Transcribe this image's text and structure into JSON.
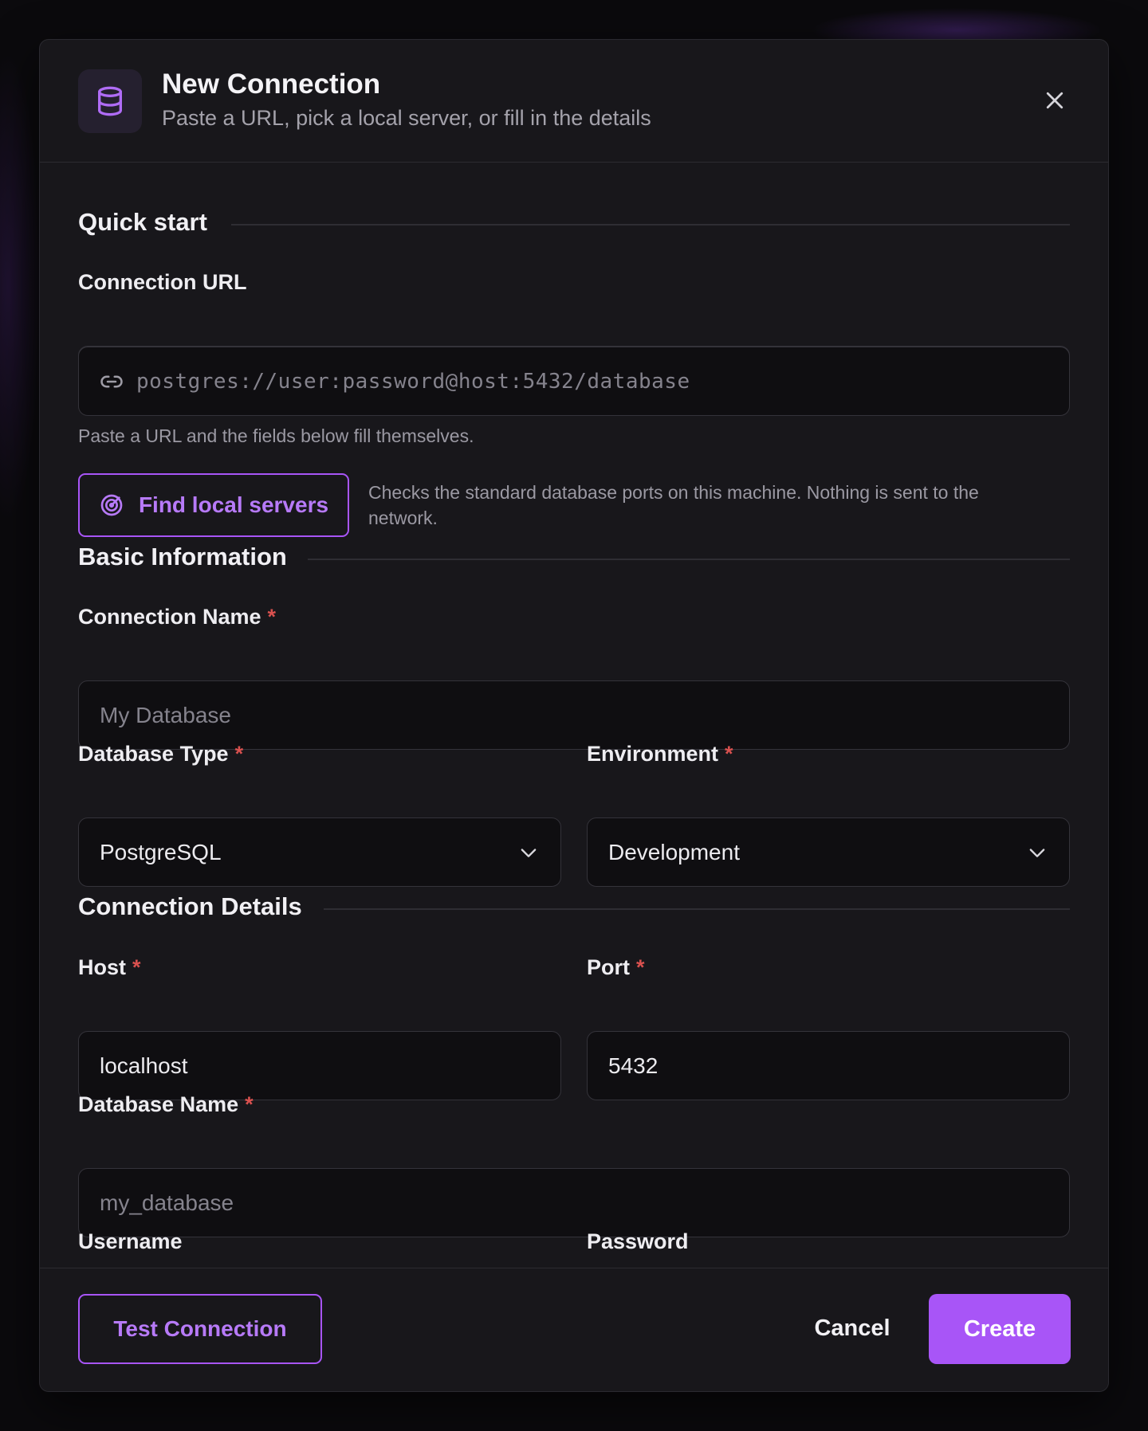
{
  "colors": {
    "accent": "#a855f7",
    "required": "#d9514f",
    "surface": "#18171b",
    "input_bg": "#0f0e11"
  },
  "dialog": {
    "title": "New Connection",
    "subtitle": "Paste a URL, pick a local server, or fill in the details",
    "header_icon": "database-icon",
    "close_icon": "close-icon"
  },
  "quick_start": {
    "title": "Quick start",
    "url_label": "Connection URL",
    "url_placeholder": "postgres://user:password@host:5432/database",
    "url_icon": "link-icon",
    "url_helper": "Paste a URL and the fields below fill themselves.",
    "find_button": "Find local servers",
    "find_icon": "radar-icon",
    "find_note": "Checks the standard database ports on this machine. Nothing is sent to the network."
  },
  "basic": {
    "title": "Basic Information",
    "name_label": "Connection Name",
    "name_placeholder": "My Database",
    "type_label": "Database Type",
    "type_value": "PostgreSQL",
    "env_label": "Environment",
    "env_value": "Development",
    "required_mark": "*"
  },
  "details": {
    "title": "Connection Details",
    "host_label": "Host",
    "host_value": "localhost",
    "port_label": "Port",
    "port_value": "5432",
    "dbname_label": "Database Name",
    "dbname_placeholder": "my_database",
    "username_label": "Username",
    "password_label": "Password"
  },
  "footer": {
    "test_button": "Test Connection",
    "cancel_button": "Cancel",
    "create_button": "Create"
  }
}
